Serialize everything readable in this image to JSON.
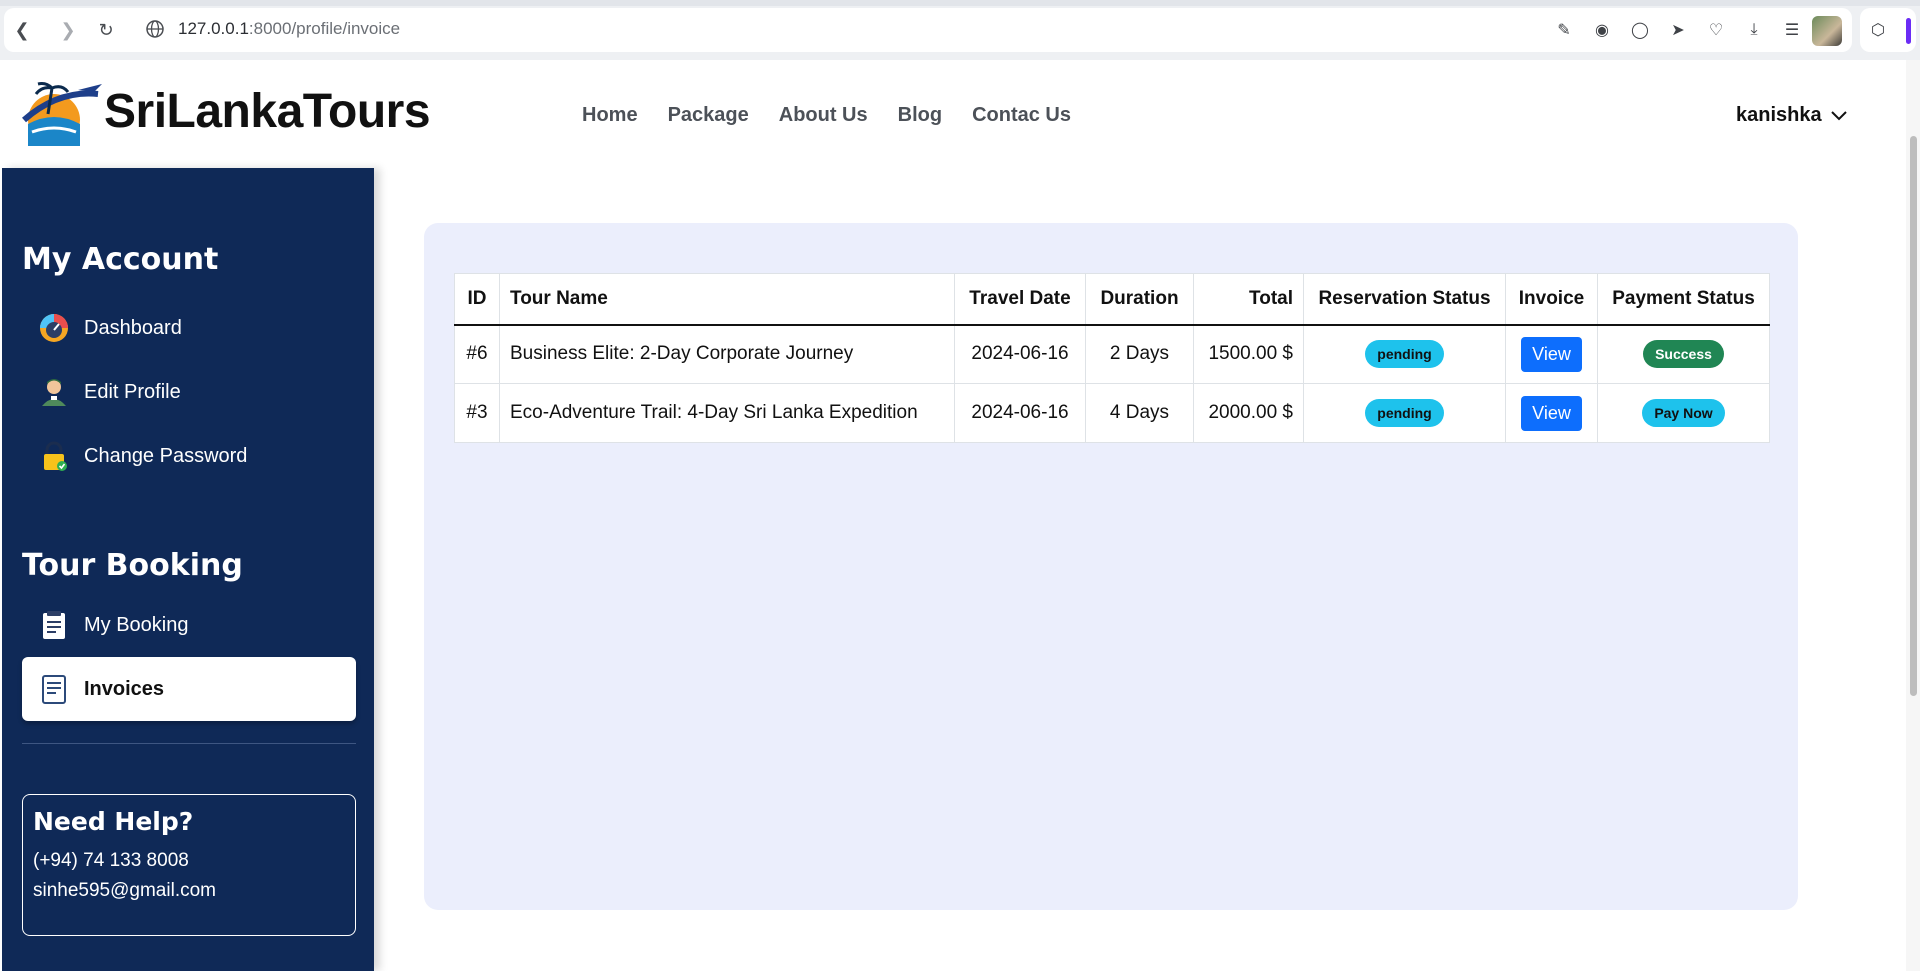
{
  "browser": {
    "url_host": "127.0.0.1",
    "url_rest": ":8000/profile/invoice"
  },
  "brand": {
    "name": "SriLankaTours"
  },
  "nav": {
    "items": [
      {
        "label": "Home"
      },
      {
        "label": "Package"
      },
      {
        "label": "About Us"
      },
      {
        "label": "Blog"
      },
      {
        "label": "Contac Us"
      }
    ]
  },
  "user": {
    "name": "kanishka"
  },
  "sidebar": {
    "account_heading": "My Account",
    "account_items": [
      {
        "label": "Dashboard",
        "icon": "dashboard-icon"
      },
      {
        "label": "Edit Profile",
        "icon": "user-icon"
      },
      {
        "label": "Change Password",
        "icon": "lock-icon"
      }
    ],
    "booking_heading": "Tour Booking",
    "booking_items": [
      {
        "label": "My Booking",
        "icon": "booking-icon"
      },
      {
        "label": "Invoices",
        "icon": "invoice-icon"
      }
    ],
    "help": {
      "title": "Need Help?",
      "phone": "(+94) 74 133 8008",
      "email": "sinhe595@gmail.com"
    }
  },
  "table": {
    "headers": {
      "id": "ID",
      "tour_name": "Tour Name",
      "travel_date": "Travel Date",
      "duration": "Duration",
      "total": "Total",
      "reservation_status": "Reservation Status",
      "invoice": "Invoice",
      "payment_status": "Payment Status"
    },
    "rows": [
      {
        "id": "#6",
        "tour_name": "Business Elite: 2-Day Corporate Journey",
        "travel_date": "2024-06-16",
        "duration": "2 Days",
        "total": "1500.00 $",
        "reservation_status": "pending",
        "invoice": "View",
        "payment_status": "Success"
      },
      {
        "id": "#3",
        "tour_name": "Eco-Adventure Trail: 4-Day Sri Lanka Expedition",
        "travel_date": "2024-06-16",
        "duration": "4 Days",
        "total": "2000.00 $",
        "reservation_status": "pending",
        "invoice": "View",
        "payment_status": "Pay Now"
      }
    ]
  },
  "colors": {
    "sidebar_bg": "#0f2957",
    "panel_bg": "#ebeefc",
    "badge_pending": "#1ec2ec",
    "badge_success": "#208654",
    "view_button": "#0d6efd"
  }
}
